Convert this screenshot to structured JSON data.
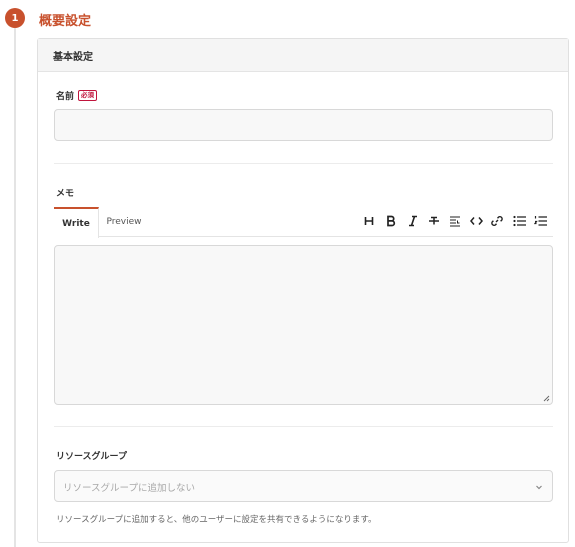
{
  "step": {
    "number": "1",
    "title": "概要設定"
  },
  "card": {
    "header": "基本設定"
  },
  "name_field": {
    "label": "名前",
    "required_badge": "必須",
    "value": ""
  },
  "memo": {
    "label": "メモ",
    "tabs": [
      "Write",
      "Preview"
    ],
    "toolbar": [
      "heading-icon",
      "bold-icon",
      "italic-icon",
      "strikethrough-icon",
      "quote-icon",
      "code-icon",
      "link-icon",
      "bulleted-list-icon",
      "numbered-list-icon"
    ],
    "value": ""
  },
  "resource_group": {
    "label": "リソースグループ",
    "selected": "リソースグループに追加しない",
    "help": "リソースグループに追加すると、他のユーザーに設定を共有できるようになります。"
  },
  "colors": {
    "accent": "#c8512d",
    "required": "#c0143c"
  }
}
